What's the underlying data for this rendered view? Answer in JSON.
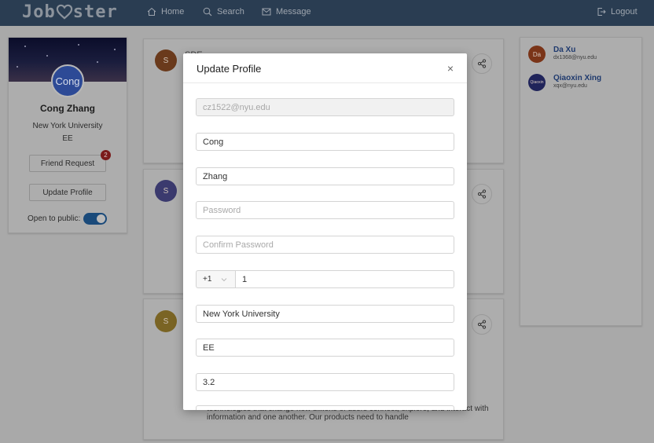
{
  "app": {
    "logo_text_left": "Job",
    "logo_text_right": "ster",
    "nav": {
      "home": "Home",
      "search": "Search",
      "message": "Message",
      "logout": "Logout"
    }
  },
  "profile": {
    "avatar_text": "Cong",
    "name": "Cong Zhang",
    "university": "New York University",
    "department": "EE",
    "friend_request_label": "Friend Request",
    "friend_request_count": "2",
    "update_profile_label": "Update Profile",
    "public_label": "Open to public:",
    "public_enabled": true
  },
  "posts": [
    {
      "avatar_text": "S",
      "avatar_color": "#6a3a1c",
      "title_fragment": "SDE"
    },
    {
      "avatar_text": "S",
      "avatar_color": "#3b3a6e"
    },
    {
      "avatar_text": "S",
      "avatar_color": "#7a6424",
      "body": "technologies that change how billions of users connect, explore, and interact with information and one another. Our products need to handle"
    }
  ],
  "friends": [
    {
      "avatar_text": "Da",
      "avatar_color": "#7a3418",
      "name": "Da Xu",
      "email": "dx1368@nyu.edu"
    },
    {
      "avatar_text": "Qiaoxin",
      "avatar_color": "#20245a",
      "name": "Qiaoxin Xing",
      "email": "xqx@nyu.edu"
    }
  ],
  "modal": {
    "title": "Update Profile",
    "close_label": "×",
    "fields": {
      "email": "cz1522@nyu.edu",
      "first_name": "Cong",
      "last_name": "Zhang",
      "password_placeholder": "Password",
      "confirm_password_placeholder": "Confirm Password",
      "country_code": "+1",
      "phone": "1",
      "university": "New York University",
      "department": "EE",
      "gpa": "3.2"
    }
  },
  "colors": {
    "topbar": "#2a3d52",
    "overlay": "#a9a9a9",
    "accent": "#1f3a6e",
    "badge": "#7a1a1a"
  },
  "icons": {
    "home": "home-icon",
    "search": "search-icon",
    "message": "mail-icon",
    "logout": "logout-icon",
    "share": "share-icon",
    "close": "close-icon"
  }
}
